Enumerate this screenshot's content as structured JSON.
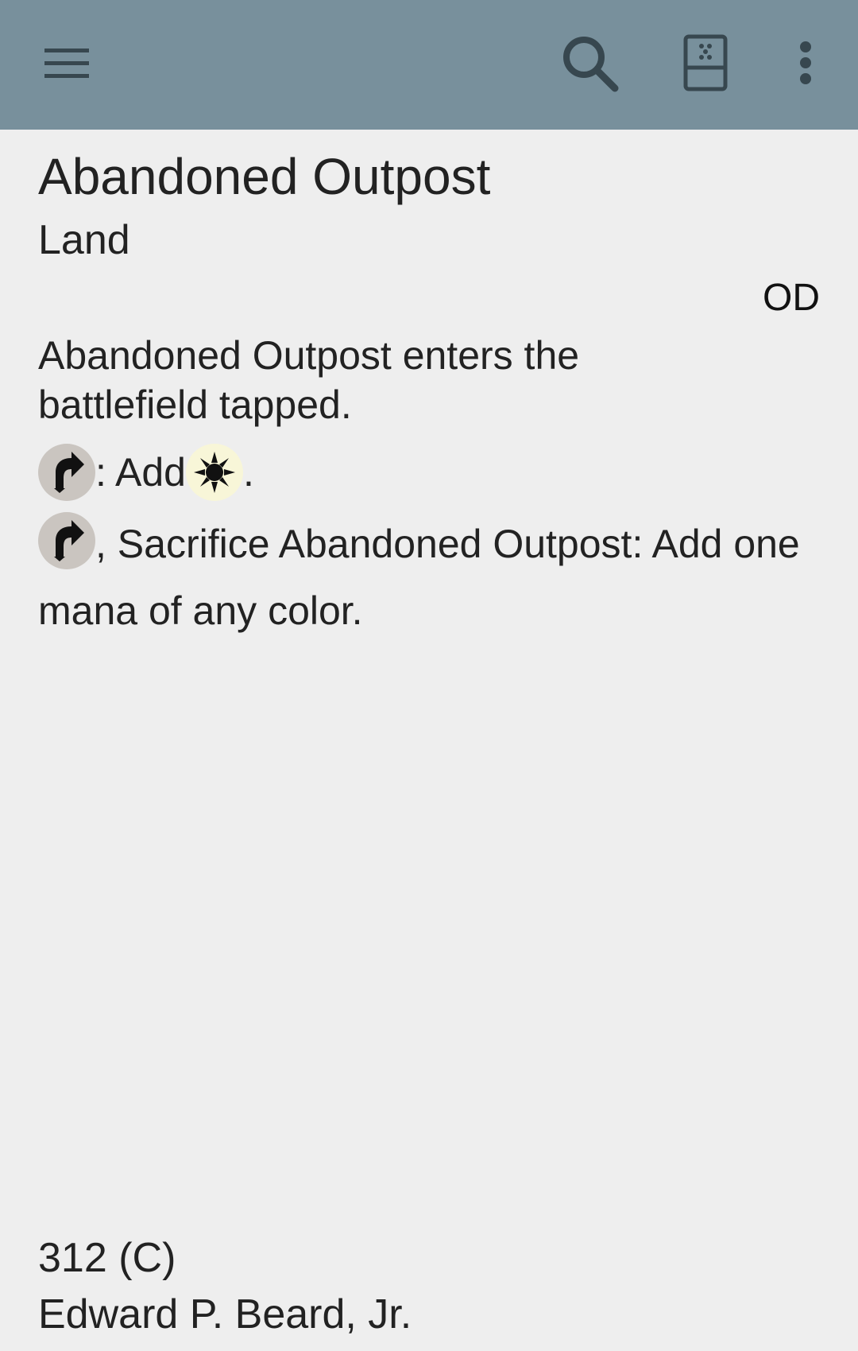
{
  "appbar": {
    "background": "#78909c",
    "icons": {
      "menu": "hamburger-menu-icon",
      "search": "search-icon",
      "deck": "deck-icon",
      "more": "more-vert-icon"
    }
  },
  "card": {
    "name": "Abandoned Outpost",
    "type": "Land",
    "set_code": "OD",
    "rules": {
      "line1": "Abandoned Outpost enters the battlefield tapped.",
      "line2_text": ": Add ",
      "line2_end": ".",
      "line3_text": ", Sacrifice Abandoned Outpost: Add one mana of any color."
    },
    "symbols": {
      "tap": "tap-symbol-icon",
      "white_mana": "white-mana-icon"
    },
    "collector_info": "312 (C)",
    "artist": "Edward P. Beard, Jr."
  }
}
